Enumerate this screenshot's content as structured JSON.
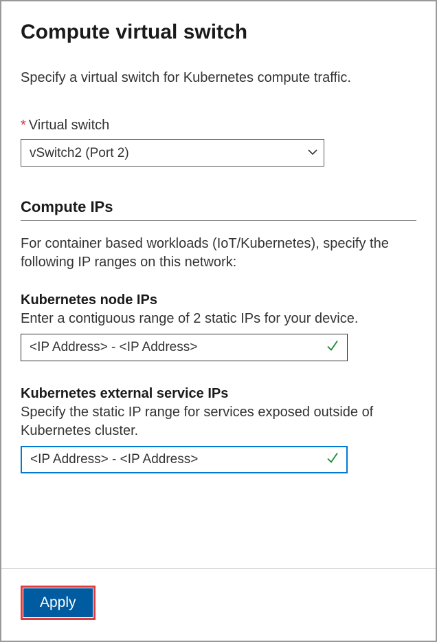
{
  "header": {
    "title": "Compute virtual switch"
  },
  "description": "Specify a virtual switch for Kubernetes compute traffic.",
  "virtual_switch": {
    "label": "Virtual switch",
    "selected": "vSwitch2 (Port 2)"
  },
  "compute_ips": {
    "heading": "Compute IPs",
    "description": "For container based workloads (IoT/Kubernetes), specify the following IP ranges on this network:"
  },
  "node_ips": {
    "title": "Kubernetes node IPs",
    "description": "Enter a contiguous range of 2 static IPs for your device.",
    "placeholder": "<IP Address> - <IP Address>"
  },
  "service_ips": {
    "title": "Kubernetes external service IPs",
    "description": "Specify the static IP range for services exposed outside of Kubernetes cluster.",
    "placeholder": "<IP Address> - <IP Address>"
  },
  "footer": {
    "apply_label": "Apply"
  }
}
